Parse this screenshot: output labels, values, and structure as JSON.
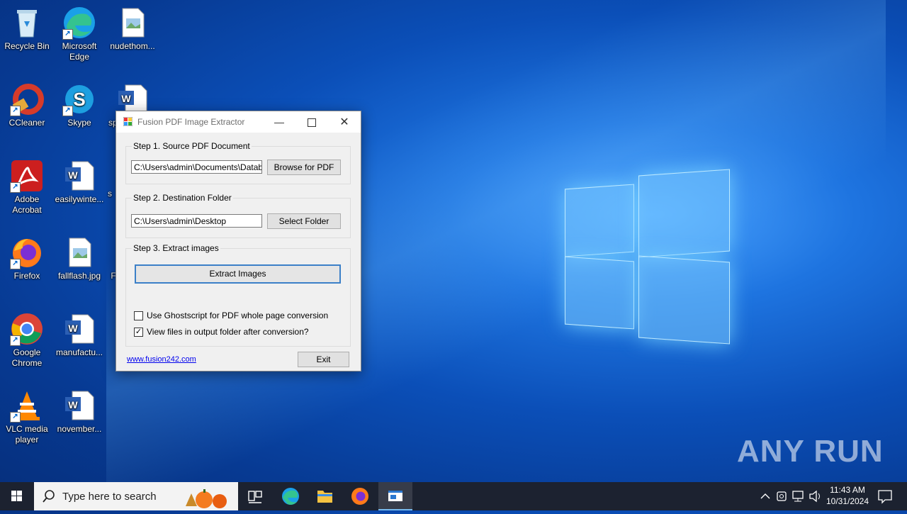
{
  "desktop": {
    "icons": [
      {
        "label": "Recycle Bin"
      },
      {
        "label": "Microsoft Edge"
      },
      {
        "label": "nudethom..."
      },
      {
        "label": "CCleaner"
      },
      {
        "label": "Skype"
      },
      {
        "label": "sp"
      },
      {
        "label": "Adobe Acrobat"
      },
      {
        "label": "easilywinte..."
      },
      {
        "label": "s"
      },
      {
        "label": "Firefox"
      },
      {
        "label": "fallflash.jpg"
      },
      {
        "label": "F"
      },
      {
        "label": "Google Chrome"
      },
      {
        "label": "manufactu..."
      },
      {
        "label": "VLC media player"
      },
      {
        "label": "november..."
      }
    ],
    "watermark": "ANY RUN"
  },
  "window": {
    "title": "Fusion PDF Image Extractor",
    "step1": {
      "label": "Step 1.   Source PDF Document",
      "path": "C:\\Users\\admin\\Documents\\Databas",
      "button": "Browse for PDF"
    },
    "step2": {
      "label": "Step 2.   Destination Folder",
      "path": "C:\\Users\\admin\\Desktop",
      "button": "Select Folder"
    },
    "step3": {
      "label": "Step 3.  Extract images",
      "button": "Extract Images"
    },
    "options": [
      {
        "label": "Use Ghostscript for PDF whole page conversion",
        "checked": false
      },
      {
        "label": "View files in output folder after conversion?",
        "checked": true
      }
    ],
    "link": "www.fusion242.com",
    "exit": "Exit"
  },
  "taskbar": {
    "search_placeholder": "Type here to search",
    "time": "11:43 AM",
    "date": "10/31/2024"
  }
}
